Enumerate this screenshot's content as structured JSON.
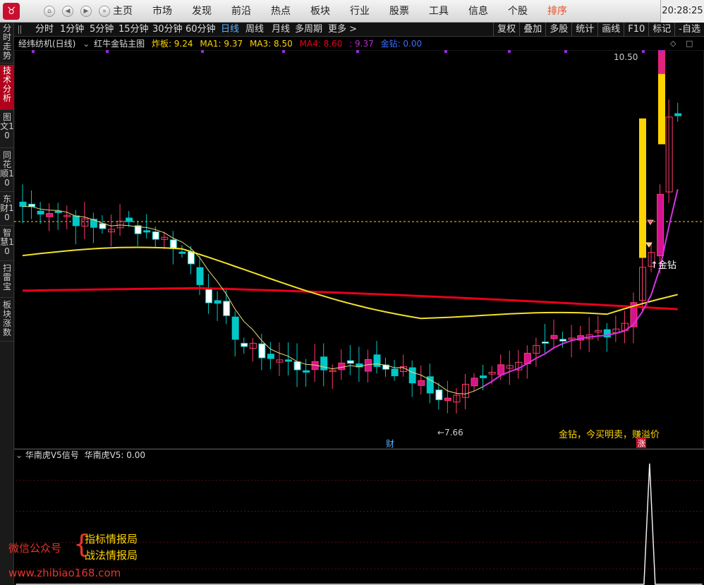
{
  "nav": {
    "menu": [
      "主页",
      "市场",
      "发现",
      "前沿",
      "热点",
      "板块",
      "行业",
      "股票",
      "工具",
      "信息",
      "个股",
      "排序"
    ],
    "time": "20:28:25"
  },
  "sidebar": {
    "tabs": [
      "分时走势",
      "技术分析",
      "图文10",
      "同花顺10",
      "东财10",
      "智慧10",
      "扫雷宝",
      "板块涨数"
    ]
  },
  "periods": {
    "items": [
      "分时",
      "1分钟",
      "5分钟",
      "15分钟",
      "30分钟",
      "60分钟",
      "日线",
      "周线",
      "月线",
      "多周期",
      "更多 >"
    ],
    "active": "日线"
  },
  "tools": [
    "复权",
    "叠加",
    "多股",
    "统计",
    "画线",
    "F10",
    "标记",
    "-自选"
  ],
  "indicators": {
    "stock": "经纬纺机(日线)",
    "formula": "红牛金钻主图",
    "zhaban": "炸板: 9.24",
    "ma1": "MA1: 9.37",
    "ma3": "MA3: 8.50",
    "ma4": "MA4: 8.60",
    "extra": ": 9.37",
    "jinzuan": "金钻: 0.00",
    "colors": {
      "zhaban": "#ffd500",
      "ma1": "#ffd500",
      "ma3": "#ffd500",
      "ma4": "#e8001c",
      "extra": "#c026d3",
      "jinzuan": "#3b6cff"
    }
  },
  "chart": {
    "high_label": "10.50",
    "low_label": "7.66",
    "signal_label": "↑金钻",
    "caption": "金钻，今买明卖，赚溢价",
    "cai_label": "财",
    "zhang_label": "涨"
  },
  "sub": {
    "title": "华南虎V5信号",
    "value": "华南虎V5: 0.00"
  },
  "watermark": {
    "wechat": "微信公众号",
    "brace": "{",
    "line1": "指标情报局",
    "line2": "战法情报局",
    "url": "www.zhibiao168.com"
  }
}
